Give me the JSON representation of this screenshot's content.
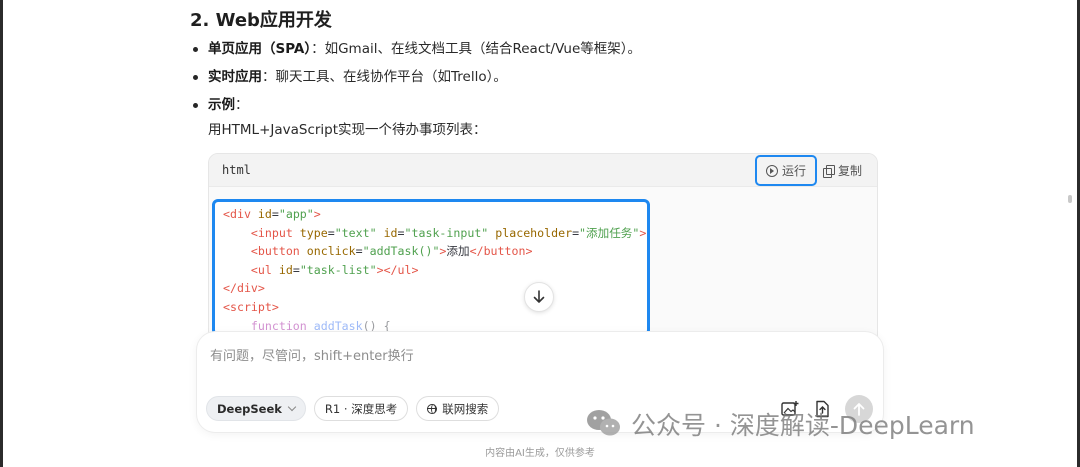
{
  "article": {
    "heading": "2. Web应用开发",
    "bullets": [
      {
        "label": "单页应用（SPA）",
        "text": "：如Gmail、在线文档工具（结合React/Vue等框架）。"
      },
      {
        "label": "实时应用",
        "text": "：聊天工具、在线协作平台（如Trello）。"
      },
      {
        "label": "示例",
        "text": "："
      }
    ],
    "example_intro": "用HTML+JavaScript实现一个待办事项列表："
  },
  "codeblock": {
    "language": "html",
    "run_label": "运行",
    "copy_label": "复制",
    "accent_color": "#1e88f0",
    "lines": {
      "l1": {
        "open": "<div",
        "attr1": "id",
        "val1": "\"app\"",
        "close": ">"
      },
      "l2": {
        "open": "<input",
        "attr1": "type",
        "val1": "\"text\"",
        "attr2": "id",
        "val2": "\"task-input\"",
        "attr3": "placeholder",
        "val3": "\"添加任务\"",
        "close": ">"
      },
      "l3": {
        "open": "<button",
        "attr1": "onclick",
        "val1": "\"addTask()\"",
        "mid": ">",
        "text": "添加",
        "close": "</button>"
      },
      "l4": {
        "open": "<ul",
        "attr1": "id",
        "val1": "\"task-list\"",
        "mid": "></",
        "close_tag": "ul",
        "end": ">"
      },
      "l5": {
        "close": "</div>"
      },
      "l6": {
        "open": "<script>"
      },
      "l7": {
        "keyword": "function",
        "fname": "addTask",
        "rest": "() {"
      }
    }
  },
  "composer": {
    "placeholder": "有问题，尽管问，shift+enter换行",
    "model_label": "DeepSeek",
    "deep_think_label": "R1 · 深度思考",
    "web_search_label": "联网搜索"
  },
  "footer": "内容由AI生成，仅供参考",
  "watermark": "公众号 · 深度解读-DeepLearn",
  "icons": {
    "run": "play-circle-icon",
    "copy": "copy-icon",
    "scroll": "arrow-down-icon",
    "image": "image-add-icon",
    "upload": "upload-file-icon",
    "send": "send-icon"
  }
}
